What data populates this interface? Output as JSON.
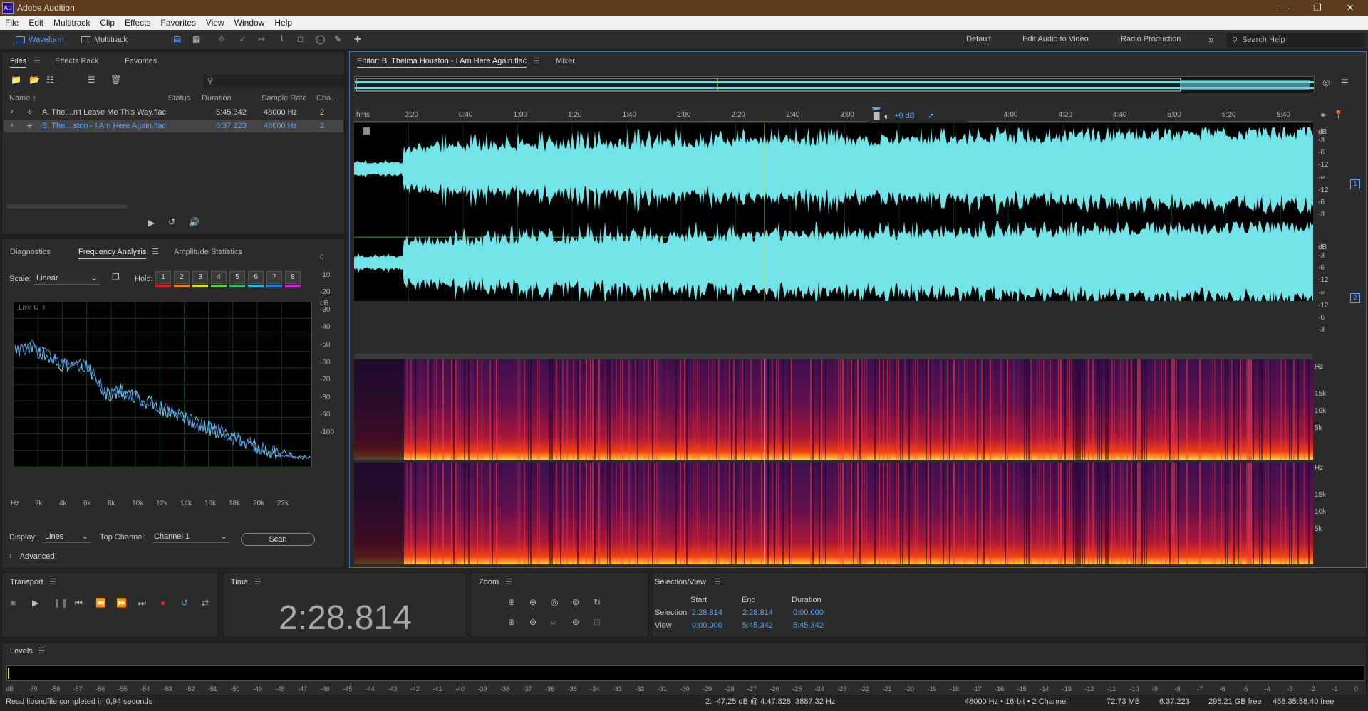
{
  "app": {
    "title": "Adobe Audition",
    "logo_text": "Au"
  },
  "menu": [
    "File",
    "Edit",
    "Multitrack",
    "Clip",
    "Effects",
    "Favorites",
    "View",
    "Window",
    "Help"
  ],
  "toolbar": {
    "waveform": "Waveform",
    "multitrack": "Multitrack",
    "workspaces": [
      "Default",
      "Edit Audio to Video",
      "Radio Production"
    ],
    "more": "»",
    "search_placeholder": "Search Help"
  },
  "files_panel": {
    "tabs": [
      "Files",
      "Effects Rack",
      "Favorites"
    ],
    "columns": [
      "Name ↑",
      "Status",
      "Duration",
      "Sample Rate",
      "Cha..."
    ],
    "rows": [
      {
        "name": "A. Thel...n't Leave Me This Way.flac",
        "status": "",
        "duration": "5:45.342",
        "rate": "48000 Hz",
        "channels": "2"
      },
      {
        "name": "B. Thel...ston - I Am Here Again.flac",
        "status": "",
        "duration": "6:37.223",
        "rate": "48000 Hz",
        "channels": "2"
      }
    ]
  },
  "analysis": {
    "tabs": [
      "Diagnostics",
      "Frequency Analysis",
      "Amplitude Statistics"
    ],
    "scale_label": "Scale:",
    "scale_value": "Linear",
    "hold_label": "Hold:",
    "hold": [
      "1",
      "2",
      "3",
      "4",
      "5",
      "6",
      "7",
      "8"
    ],
    "hold_colors": [
      "#e02020",
      "#f08020",
      "#e0e020",
      "#60d040",
      "#30c060",
      "#20c0e0",
      "#2080f0",
      "#e020e0"
    ],
    "live": "Live CTI",
    "db_label": "dB",
    "db_ticks": [
      "0",
      "-10",
      "-20",
      "-30",
      "-40",
      "-50",
      "-60",
      "-70",
      "-80",
      "-90",
      "-100"
    ],
    "hz_ticks": [
      "Hz",
      "2k",
      "4k",
      "6k",
      "8k",
      "10k",
      "12k",
      "14k",
      "16k",
      "18k",
      "20k",
      "22k"
    ],
    "display_label": "Display:",
    "display_value": "Lines",
    "top_channel_label": "Top Channel:",
    "top_channel_value": "Channel 1",
    "scan": "Scan",
    "advanced": "Advanced"
  },
  "editor": {
    "tab": "Editor: B. Thelma Houston - I Am Here Again.flac",
    "mixer": "Mixer",
    "ruler": [
      "hms",
      "0:20",
      "0:40",
      "1:00",
      "1:20",
      "1:40",
      "2:00",
      "2:20",
      "2:40",
      "3:00",
      "3:20",
      "3:40",
      "4:00",
      "4:20",
      "4:40",
      "5:00",
      "5:20",
      "5:40"
    ],
    "gain": "+0 dB",
    "db_scale": [
      "dB",
      "-3",
      "-6",
      "-12",
      "-∞",
      "-12",
      "-6",
      "-3"
    ],
    "ch1": "1",
    "ch2": "2",
    "hz_scale": [
      "Hz",
      "15k",
      "10k",
      "5k"
    ],
    "playhead_fraction": 0.428
  },
  "transport": {
    "title": "Transport"
  },
  "time": {
    "title": "Time",
    "value": "2:28.814"
  },
  "zoom": {
    "title": "Zoom"
  },
  "selection": {
    "title": "Selection/View",
    "headers": [
      "Start",
      "End",
      "Duration"
    ],
    "selection_label": "Selection",
    "selection": [
      "2:28.814",
      "2:28.814",
      "0:00.000"
    ],
    "view_label": "View",
    "view": [
      "0:00.000",
      "5:45.342",
      "5:45.342"
    ]
  },
  "levels": {
    "title": "Levels",
    "ticks": [
      "dB",
      "-59",
      "-58",
      "-57",
      "-56",
      "-55",
      "-54",
      "-53",
      "-52",
      "-51",
      "-50",
      "-49",
      "-48",
      "-47",
      "-46",
      "-45",
      "-44",
      "-43",
      "-42",
      "-41",
      "-40",
      "-39",
      "-38",
      "-37",
      "-36",
      "-35",
      "-34",
      "-33",
      "-32",
      "-31",
      "-30",
      "-29",
      "-28",
      "-27",
      "-26",
      "-25",
      "-24",
      "-23",
      "-22",
      "-21",
      "-20",
      "-19",
      "-18",
      "-17",
      "-16",
      "-15",
      "-14",
      "-13",
      "-12",
      "-11",
      "-10",
      "-9",
      "-8",
      "-7",
      "-6",
      "-5",
      "-4",
      "-3",
      "-2",
      "-1",
      "0"
    ]
  },
  "status": {
    "message": "Read libsndfile completed in 0,94 seconds",
    "cursor": "2: -47,25 dB @ 4:47.828, 3887,32 Hz",
    "format": "48000 Hz • 16-bit • 2 Channel",
    "size": "72,73 MB",
    "duration": "6:37.223",
    "free": "295,21 GB free",
    "free_time": "458:35:58.40 free"
  }
}
